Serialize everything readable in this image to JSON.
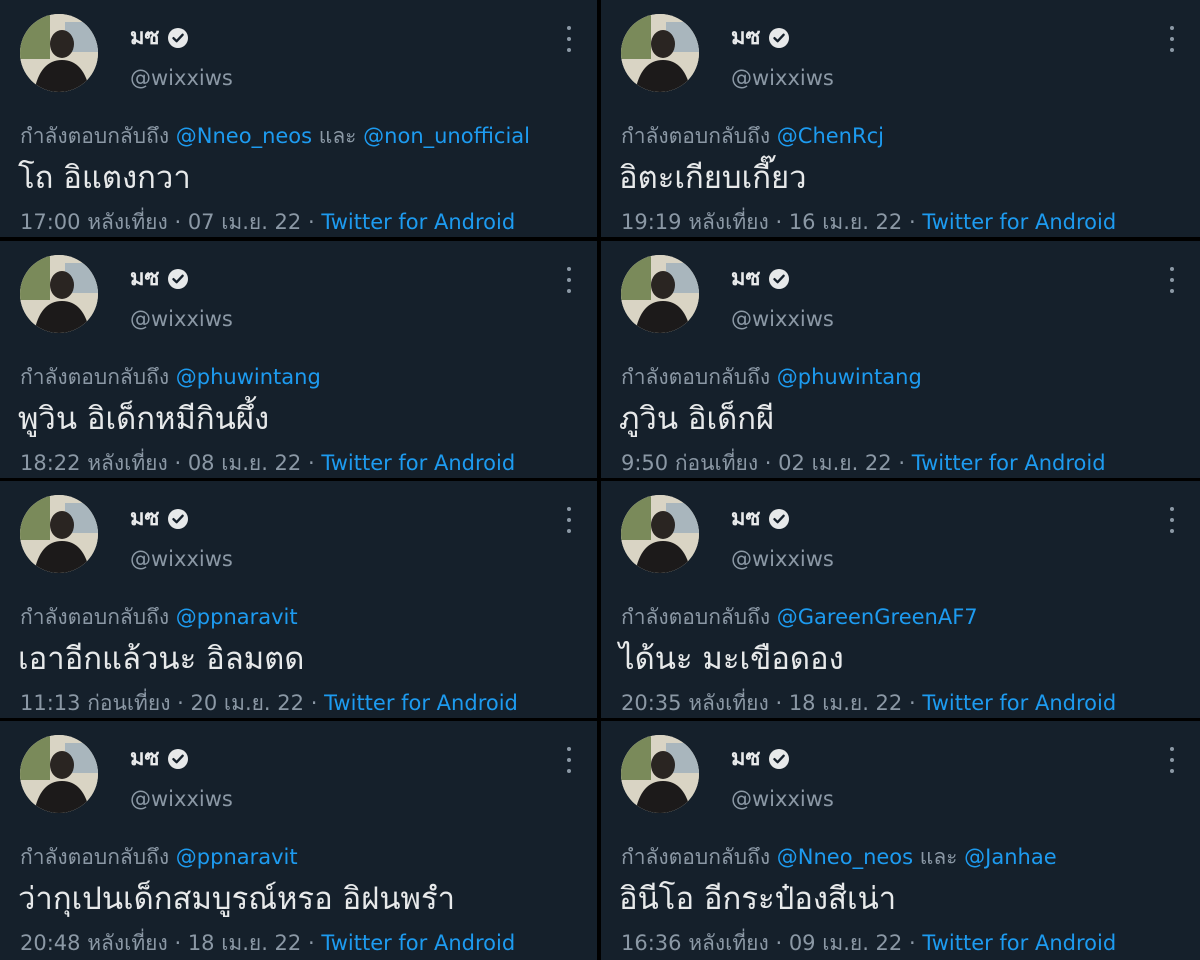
{
  "colors": {
    "background": "#15202b",
    "separator": "#000000",
    "text_primary": "#e7e9ea",
    "text_secondary": "#8b98a5",
    "accent": "#1d9bf0"
  },
  "icons": {
    "verified": "verified-badge-icon",
    "more": "more-vertical-dots-icon"
  },
  "tweets": [
    {
      "display_name": "มซ",
      "handle": "@wixxiws",
      "reply_prefix": "กำลังตอบกลับถึง",
      "mentions": [
        "@Nneo_neos",
        "@non_unofficial"
      ],
      "mention_join": "และ",
      "text": "โถ อิแตงกวา",
      "time": "17:00 หลังเที่ยง",
      "date": "07 เม.ย. 22",
      "source": "Twitter for Android",
      "separator": "·"
    },
    {
      "display_name": "มซ",
      "handle": "@wixxiws",
      "reply_prefix": "กำลังตอบกลับถึง",
      "mentions": [
        "@ChenRcj"
      ],
      "mention_join": "",
      "text": "อิตะเกียบเกี๊ยว",
      "time": "19:19 หลังเที่ยง",
      "date": "16 เม.ย. 22",
      "source": "Twitter for Android",
      "separator": "·"
    },
    {
      "display_name": "มซ",
      "handle": "@wixxiws",
      "reply_prefix": "กำลังตอบกลับถึง",
      "mentions": [
        "@phuwintang"
      ],
      "mention_join": "",
      "text": "พูวิน อิเด็กหมีกินผึ้ง",
      "time": "18:22 หลังเที่ยง",
      "date": "08 เม.ย. 22",
      "source": "Twitter for Android",
      "separator": "·"
    },
    {
      "display_name": "มซ",
      "handle": "@wixxiws",
      "reply_prefix": "กำลังตอบกลับถึง",
      "mentions": [
        "@phuwintang"
      ],
      "mention_join": "",
      "text": "ภูวิน อิเด็กผี",
      "time": "9:50 ก่อนเที่ยง",
      "date": "02 เม.ย. 22",
      "source": "Twitter for Android",
      "separator": "·"
    },
    {
      "display_name": "มซ",
      "handle": "@wixxiws",
      "reply_prefix": "กำลังตอบกลับถึง",
      "mentions": [
        "@ppnaravit"
      ],
      "mention_join": "",
      "text": "เอาอีกแล้วนะ อิลมตด",
      "time": "11:13 ก่อนเที่ยง",
      "date": "20 เม.ย. 22",
      "source": "Twitter for Android",
      "separator": "·"
    },
    {
      "display_name": "มซ",
      "handle": "@wixxiws",
      "reply_prefix": "กำลังตอบกลับถึง",
      "mentions": [
        "@GareenGreenAF7"
      ],
      "mention_join": "",
      "text": "ได้นะ มะเขือดอง",
      "time": "20:35 หลังเที่ยง",
      "date": "18 เม.ย. 22",
      "source": "Twitter for Android",
      "separator": "·"
    },
    {
      "display_name": "มซ",
      "handle": "@wixxiws",
      "reply_prefix": "กำลังตอบกลับถึง",
      "mentions": [
        "@ppnaravit"
      ],
      "mention_join": "",
      "text": "ว่ากุเปนเด็กสมบูรณ์หรอ อิฝนพรำ",
      "time": "20:48 หลังเที่ยง",
      "date": "18 เม.ย. 22",
      "source": "Twitter for Android",
      "separator": "·"
    },
    {
      "display_name": "มซ",
      "handle": "@wixxiws",
      "reply_prefix": "กำลังตอบกลับถึง",
      "mentions": [
        "@Nneo_neos",
        "@Janhae"
      ],
      "mention_join": "และ",
      "text": "อินีโอ อีกระป๋องสีเน่า",
      "time": "16:36 หลังเที่ยง",
      "date": "09 เม.ย. 22",
      "source": "Twitter for Android",
      "separator": "·"
    }
  ]
}
